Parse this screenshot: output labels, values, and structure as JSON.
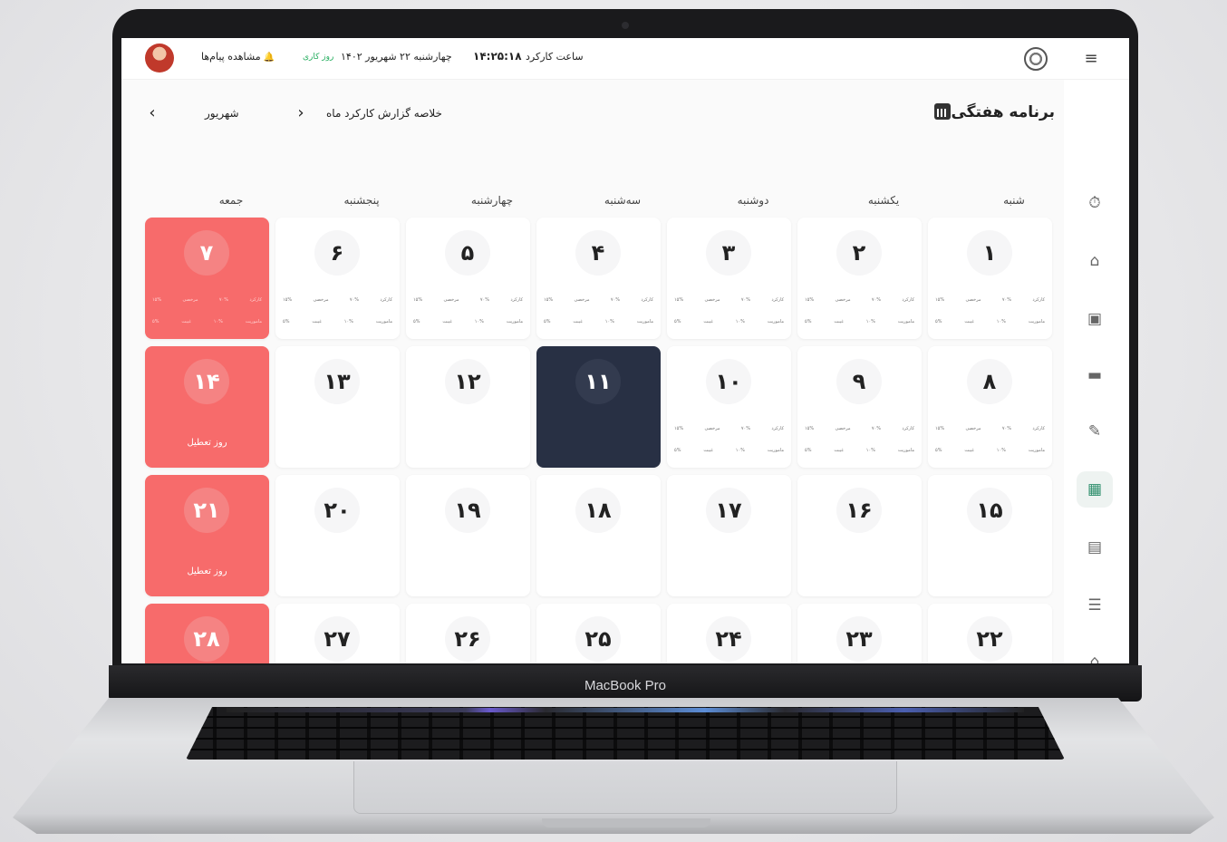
{
  "device": {
    "brand": "MacBook Pro"
  },
  "topbar": {
    "messages_label": "مشاهده پیام‌ها",
    "work_status": "روز کاری",
    "date": "چهارشنبه ۲۲ شهریور ۱۴۰۲",
    "time": "۱۴:۲۵:۱۸",
    "work_time_label": "ساعت کارکرد"
  },
  "header": {
    "title": "برنامه هفتگی",
    "summary_label": "خلاصه گزارش کارکرد ماه",
    "month": "شهریور"
  },
  "weekdays": [
    "شنبه",
    "یکشنبه",
    "دوشنبه",
    "سه‌شنبه",
    "چهارشنبه",
    "پنجشنبه",
    "جمعه"
  ],
  "holiday_label": "روز تعطیل",
  "sidebar_icons": [
    "clock-icon",
    "home-icon",
    "briefcase-icon",
    "bed-icon",
    "edit-calendar-icon",
    "calendar-icon",
    "box-icon",
    "burger-icon",
    "basket-icon"
  ],
  "stat_labels": {
    "work": "کارکرد",
    "leave": "مرخصی",
    "mission": "ماموریت",
    "absence": "غیبت",
    "work_pct": "۷۰%",
    "leave_pct": "۱۵%",
    "mission_pct": "۱۰%",
    "absence_pct": "۵%"
  },
  "weeks": [
    [
      "۱",
      "۲",
      "۳",
      "۴",
      "۵",
      "۶",
      "۷"
    ],
    [
      "۸",
      "۹",
      "۱۰",
      "۱۱",
      "۱۲",
      "۱۳",
      "۱۴"
    ],
    [
      "۱۵",
      "۱۶",
      "۱۷",
      "۱۸",
      "۱۹",
      "۲۰",
      "۲۱"
    ],
    [
      "۲۲",
      "۲۳",
      "۲۴",
      "۲۵",
      "۲۶",
      "۲۷",
      "۲۸"
    ]
  ]
}
